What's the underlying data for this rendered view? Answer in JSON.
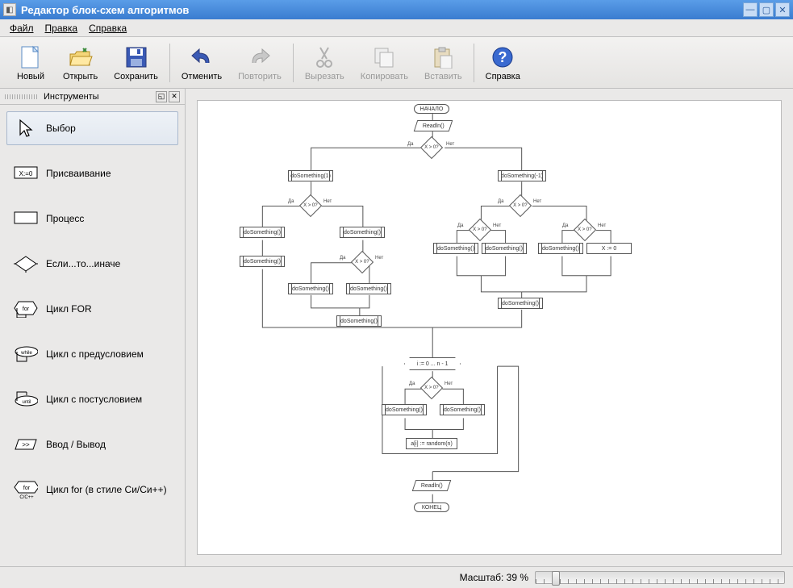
{
  "window": {
    "title": "Редактор блок-схем алгоритмов"
  },
  "menu": {
    "file": "Файл",
    "edit": "Правка",
    "help": "Справка"
  },
  "toolbar": {
    "new": "Новый",
    "open": "Открыть",
    "save": "Сохранить",
    "undo": "Отменить",
    "redo": "Повторить",
    "cut": "Вырезать",
    "copy": "Копировать",
    "paste": "Вставить",
    "help": "Справка"
  },
  "tools_panel": {
    "title": "Инструменты",
    "items": [
      {
        "label": "Выбор",
        "icon": "cursor-icon",
        "selected": true
      },
      {
        "label": "Присваивание",
        "icon": "assign-icon",
        "selected": false
      },
      {
        "label": "Процесс",
        "icon": "process-icon",
        "selected": false
      },
      {
        "label": "Если...то...иначе",
        "icon": "decision-icon",
        "selected": false
      },
      {
        "label": "Цикл FOR",
        "icon": "for-icon",
        "selected": false
      },
      {
        "label": "Цикл с предусловием",
        "icon": "while-icon",
        "selected": false
      },
      {
        "label": "Цикл с постусловием",
        "icon": "until-icon",
        "selected": false
      },
      {
        "label": "Ввод / Вывод",
        "icon": "io-icon",
        "selected": false
      },
      {
        "label": "Цикл for (в стиле Си/Си++)",
        "icon": "cfor-icon",
        "selected": false
      }
    ]
  },
  "flowchart": {
    "start": "НАЧАЛО",
    "end": "КОНЕЦ",
    "readln": "Readln()",
    "cond": "X > 0?",
    "yes": "Да",
    "no": "Нет",
    "ds": "doSomething()",
    "ds1": "doSomething(1)",
    "dsm1": "doSomething(-1)",
    "xeq0": "X := 0",
    "forhdr": "i := 0 ... n - 1",
    "arr": "a[i] := random(n)"
  },
  "status": {
    "zoom_label": "Масштаб: 39 %",
    "zoom_value": 39
  }
}
